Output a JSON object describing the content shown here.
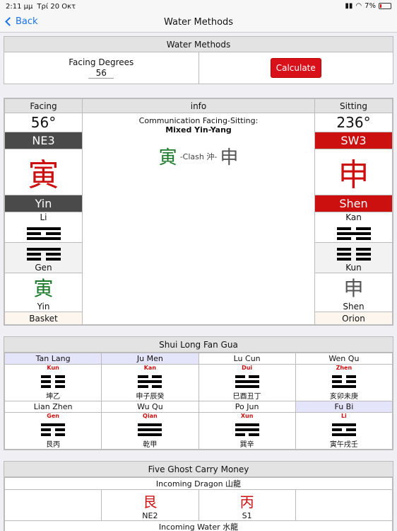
{
  "status": {
    "time": "2:11 μμ",
    "date": "Τρί 20 Οκτ",
    "battery": "7%"
  },
  "nav": {
    "back_label": "Back",
    "title": "Water Methods"
  },
  "water_methods": {
    "header": "Water Methods",
    "facing_label": "Facing Degrees",
    "facing_value": "56",
    "calculate_label": "Calculate"
  },
  "main": {
    "headers": {
      "facing": "Facing",
      "info": "info",
      "sitting": "Sitting"
    },
    "info": {
      "title": "Communication Facing-Sitting:",
      "subtitle": "Mixed Yin-Yang",
      "char1": "寅",
      "clash_label": "-Clash 沖-",
      "char2": "申"
    },
    "facing": {
      "degrees": "56°",
      "sector": "NE3",
      "char": "寅",
      "polarity": "Yin",
      "top_trigram": "Li",
      "bottom_trigram": "Gen",
      "small_char": "寅",
      "small_label": "Yin",
      "star": "Basket",
      "sector_color": "#4a4a4a",
      "polarity_color": "#4a4a4a",
      "small_char_color": "#1a7a2a"
    },
    "sitting": {
      "degrees": "236°",
      "sector": "SW3",
      "char": "申",
      "polarity": "Shen",
      "top_trigram": "Kan",
      "bottom_trigram": "Kun",
      "small_char": "申",
      "small_label": "Shen",
      "star": "Orion",
      "sector_color": "#cc1010",
      "polarity_color": "#cc1010",
      "small_char_color": "#555555"
    }
  },
  "shui_long": {
    "header": "Shui Long Fan Gua",
    "row1": [
      {
        "name": "Tan Lang",
        "trigram": "Kun",
        "chars": "坤乙"
      },
      {
        "name": "Ju Men",
        "trigram": "Kan",
        "chars": "申子辰癸"
      },
      {
        "name": "Lu Cun",
        "trigram": "Dui",
        "chars": "巳酉丑丁"
      },
      {
        "name": "Wen Qu",
        "trigram": "Zhen",
        "chars": "亥卯未庚"
      }
    ],
    "row2": [
      {
        "name": "Lian Zhen",
        "trigram": "Gen",
        "chars": "艮丙"
      },
      {
        "name": "Wu Qu",
        "trigram": "Qian",
        "chars": "乾甲"
      },
      {
        "name": "Po Jun",
        "trigram": "Xun",
        "chars": "巽辛"
      },
      {
        "name": "Fu Bi",
        "trigram": "Li",
        "chars": "寅午戌壬"
      }
    ]
  },
  "five_ghost": {
    "header": "Five Ghost Carry Money",
    "dragon_label": "Incoming Dragon 山龍",
    "cells": [
      {
        "char": "",
        "label": ""
      },
      {
        "char": "艮",
        "label": "NE2"
      },
      {
        "char": "丙",
        "label": "S1"
      },
      {
        "char": "",
        "label": ""
      }
    ],
    "water_label": "Incoming Water 水龍"
  }
}
